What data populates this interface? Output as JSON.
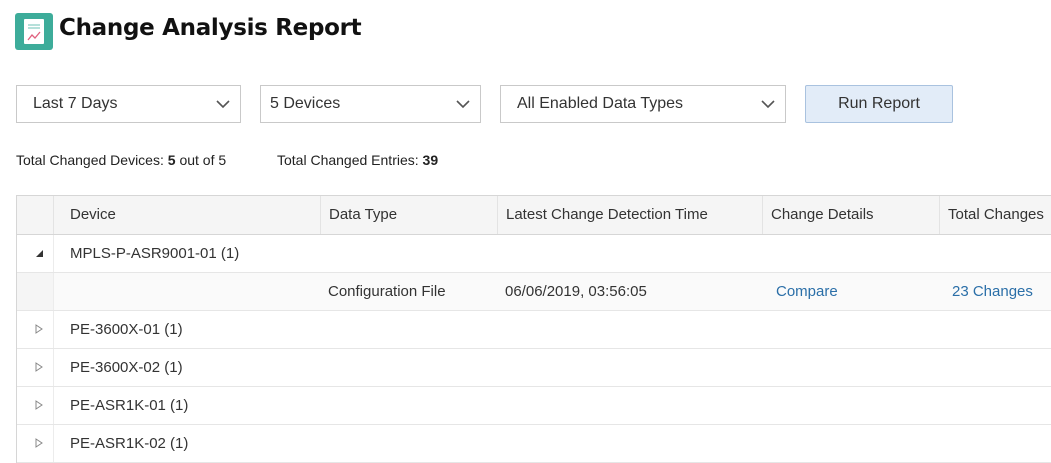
{
  "header": {
    "title": "Change Analysis Report",
    "icon": "report-icon"
  },
  "filters": {
    "time_range": "Last 7 Days",
    "devices": "5 Devices",
    "data_types": "All Enabled Data Types",
    "run_label": "Run Report"
  },
  "summary": {
    "changed_devices_label": "Total Changed Devices:",
    "changed_devices_count": "5",
    "changed_devices_total": "out of 5",
    "changed_entries_label": "Total Changed Entries:",
    "changed_entries_count": "39"
  },
  "table": {
    "columns": [
      "Device",
      "Data Type",
      "Latest Change Detection Time",
      "Change Details",
      "Total Changes"
    ],
    "rows": [
      {
        "device": "MPLS-P-ASR9001-01 (1)",
        "expanded": true
      },
      {
        "data_type": "Configuration File",
        "time": "06/06/2019, 03:56:05",
        "details": "Compare",
        "total": "23 Changes"
      },
      {
        "device": "PE-3600X-01 (1)",
        "expanded": false
      },
      {
        "device": "PE-3600X-02 (1)",
        "expanded": false
      },
      {
        "device": "PE-ASR1K-01 (1)",
        "expanded": false
      },
      {
        "device": "PE-ASR1K-02 (1)",
        "expanded": false
      }
    ]
  },
  "colors": {
    "accent": "#3dac9a",
    "link": "#2b6fa8",
    "button_bg": "#e2ecf8"
  }
}
